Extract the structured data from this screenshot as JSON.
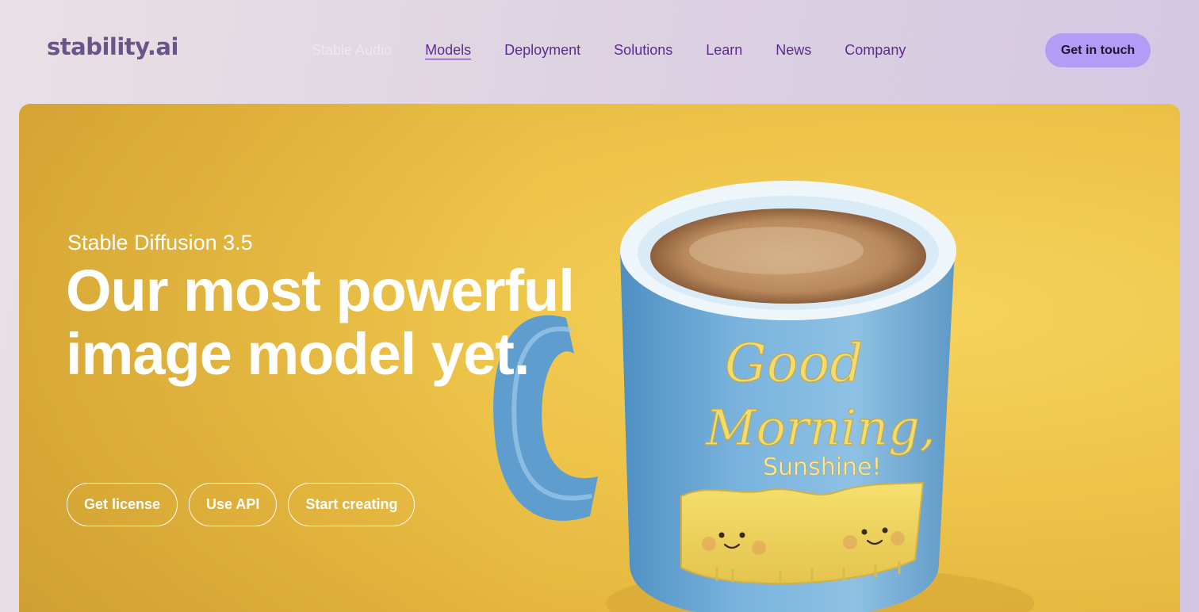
{
  "brand": {
    "logo_text": "stability.ai"
  },
  "nav": {
    "items": [
      {
        "label": "Stable Audio"
      },
      {
        "label": "Models"
      },
      {
        "label": "Deployment"
      },
      {
        "label": "Solutions"
      },
      {
        "label": "Learn"
      },
      {
        "label": "News"
      },
      {
        "label": "Company"
      }
    ],
    "active": "Models"
  },
  "header": {
    "cta_label": "Get in touch"
  },
  "hero": {
    "eyebrow": "Stable Diffusion 3.5",
    "headline": "Our most powerful image model yet.",
    "buttons": [
      {
        "label": "Get license"
      },
      {
        "label": "Use API"
      },
      {
        "label": "Start creating"
      }
    ],
    "image_text": {
      "line1": "Good",
      "line2": "Morning,",
      "line3": "Sunshine!"
    }
  },
  "colors": {
    "brand_purple": "#5e2a91",
    "cta_lavender": "#b29cf5",
    "hero_yellow": "#efc64b",
    "mug_blue": "#6ea9d4"
  }
}
